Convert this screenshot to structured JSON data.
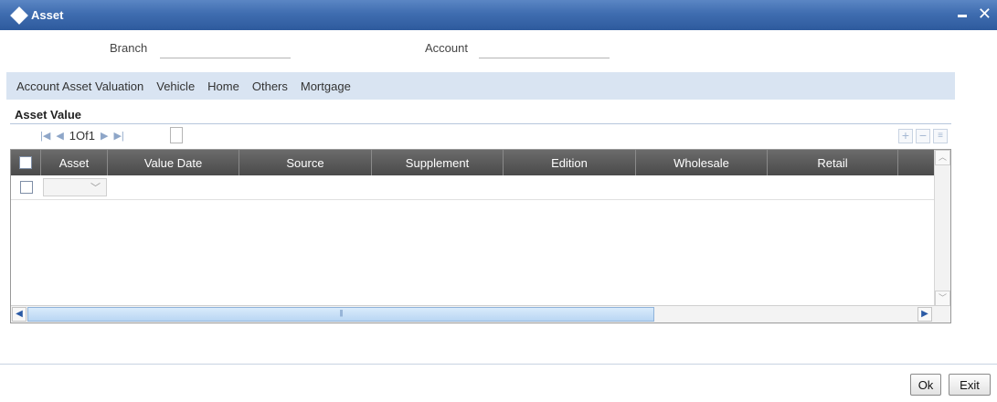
{
  "window": {
    "title": "Asset"
  },
  "header": {
    "branch_label": "Branch",
    "branch_value": "",
    "account_label": "Account",
    "account_value": ""
  },
  "tabs": [
    {
      "label": "Account Asset Valuation"
    },
    {
      "label": "Vehicle"
    },
    {
      "label": "Home"
    },
    {
      "label": "Others"
    },
    {
      "label": "Mortgage"
    }
  ],
  "section": {
    "title": "Asset Value"
  },
  "pager": {
    "text": "1Of1"
  },
  "grid": {
    "columns": [
      {
        "label": "Asset"
      },
      {
        "label": "Value Date"
      },
      {
        "label": "Source"
      },
      {
        "label": "Supplement"
      },
      {
        "label": "Edition"
      },
      {
        "label": "Wholesale"
      },
      {
        "label": "Retail"
      }
    ],
    "rows": [
      {
        "asset": ""
      }
    ]
  },
  "footer": {
    "ok_label": "Ok",
    "exit_label": "Exit"
  },
  "colors": {
    "titlebar": "#3f6db0",
    "tabstrip": "#d9e4f2",
    "grid_header": "#555555"
  }
}
